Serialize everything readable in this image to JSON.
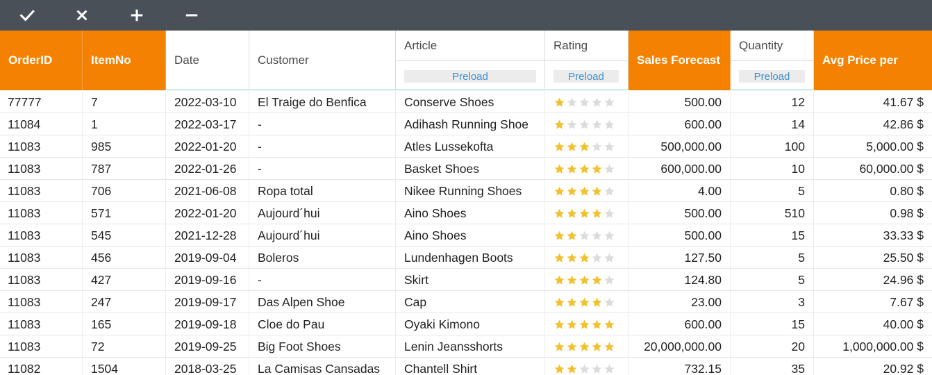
{
  "toolbar": {
    "buttons": [
      {
        "name": "confirm-button",
        "icon": "check-icon"
      },
      {
        "name": "cancel-button",
        "icon": "close-icon"
      },
      {
        "name": "add-button",
        "icon": "plus-icon"
      },
      {
        "name": "remove-button",
        "icon": "minus-icon"
      }
    ]
  },
  "colors": {
    "toolbar": "#4a5058",
    "accent": "#f58102",
    "star_on": "#f2c12e",
    "star_off": "#dcdcdc",
    "link": "#3d8fcf"
  },
  "columns": [
    {
      "key": "order_id",
      "label": "OrderID",
      "highlight": true
    },
    {
      "key": "item_no",
      "label": "ItemNo",
      "highlight": true
    },
    {
      "key": "date",
      "label": "Date"
    },
    {
      "key": "customer",
      "label": "Customer"
    },
    {
      "key": "article",
      "label": "Article",
      "filter": "Preload"
    },
    {
      "key": "rating",
      "label": "Rating",
      "filter": "Preload"
    },
    {
      "key": "sales_forecast",
      "label": "Sales Forecast",
      "highlight": true
    },
    {
      "key": "quantity",
      "label": "Quantity",
      "filter": "Preload"
    },
    {
      "key": "avg_price",
      "label": "Avg Price per",
      "highlight": true
    }
  ],
  "rows": [
    {
      "order_id": "77777",
      "item_no": "7",
      "date": "2022-03-10",
      "customer": "El Traige do Benfica",
      "article": "Conserve Shoes",
      "rating": 1,
      "sales_forecast": "500.00",
      "quantity": "12",
      "avg_price": "41.67 $"
    },
    {
      "order_id": "11084",
      "item_no": "1",
      "date": "2022-03-17",
      "customer": "-",
      "article": "Adihash Running Shoe",
      "rating": 1,
      "sales_forecast": "600.00",
      "quantity": "14",
      "avg_price": "42.86 $"
    },
    {
      "order_id": "11083",
      "item_no": "985",
      "date": "2022-01-20",
      "customer": "-",
      "article": "Atles Lussekofta",
      "rating": 3,
      "sales_forecast": "500,000.00",
      "quantity": "100",
      "avg_price": "5,000.00 $"
    },
    {
      "order_id": "11083",
      "item_no": "787",
      "date": "2022-01-26",
      "customer": "-",
      "article": "Basket Shoes",
      "rating": 4,
      "sales_forecast": "600,000.00",
      "quantity": "10",
      "avg_price": "60,000.00 $"
    },
    {
      "order_id": "11083",
      "item_no": "706",
      "date": "2021-06-08",
      "customer": "Ropa total",
      "article": "Nikee Running Shoes",
      "rating": 4,
      "sales_forecast": "4.00",
      "quantity": "5",
      "avg_price": "0.80 $"
    },
    {
      "order_id": "11083",
      "item_no": "571",
      "date": "2022-01-20",
      "customer": "Aujourd´hui",
      "article": "Aino Shoes",
      "rating": 4,
      "sales_forecast": "500.00",
      "quantity": "510",
      "avg_price": "0.98 $"
    },
    {
      "order_id": "11083",
      "item_no": "545",
      "date": "2021-12-28",
      "customer": "Aujourd´hui",
      "article": "Aino Shoes",
      "rating": 2,
      "sales_forecast": "500.00",
      "quantity": "15",
      "avg_price": "33.33 $"
    },
    {
      "order_id": "11083",
      "item_no": "456",
      "date": "2019-09-04",
      "customer": "Boleros",
      "article": "Lundenhagen Boots",
      "rating": 3,
      "sales_forecast": "127.50",
      "quantity": "5",
      "avg_price": "25.50 $"
    },
    {
      "order_id": "11083",
      "item_no": "427",
      "date": "2019-09-16",
      "customer": "-",
      "article": "Skirt",
      "rating": 4,
      "sales_forecast": "124.80",
      "quantity": "5",
      "avg_price": "24.96 $"
    },
    {
      "order_id": "11083",
      "item_no": "247",
      "date": "2019-09-17",
      "customer": "Das Alpen Shoe",
      "article": "Cap",
      "rating": 4,
      "sales_forecast": "23.00",
      "quantity": "3",
      "avg_price": "7.67 $"
    },
    {
      "order_id": "11083",
      "item_no": "165",
      "date": "2019-09-18",
      "customer": "Cloe do Pau",
      "article": "Oyaki Kimono",
      "rating": 5,
      "sales_forecast": "600.00",
      "quantity": "15",
      "avg_price": "40.00 $"
    },
    {
      "order_id": "11083",
      "item_no": "72",
      "date": "2019-09-25",
      "customer": "Big Foot Shoes",
      "article": "Lenin Jeansshorts",
      "rating": 5,
      "sales_forecast": "20,000,000.00",
      "quantity": "20",
      "avg_price": "1,000,000.00 $"
    },
    {
      "order_id": "11082",
      "item_no": "1504",
      "date": "2018-03-25",
      "customer": "La Camisas Cansadas",
      "article": "Chantell Shirt",
      "rating": 2,
      "sales_forecast": "732.15",
      "quantity": "35",
      "avg_price": "20.92 $"
    }
  ]
}
